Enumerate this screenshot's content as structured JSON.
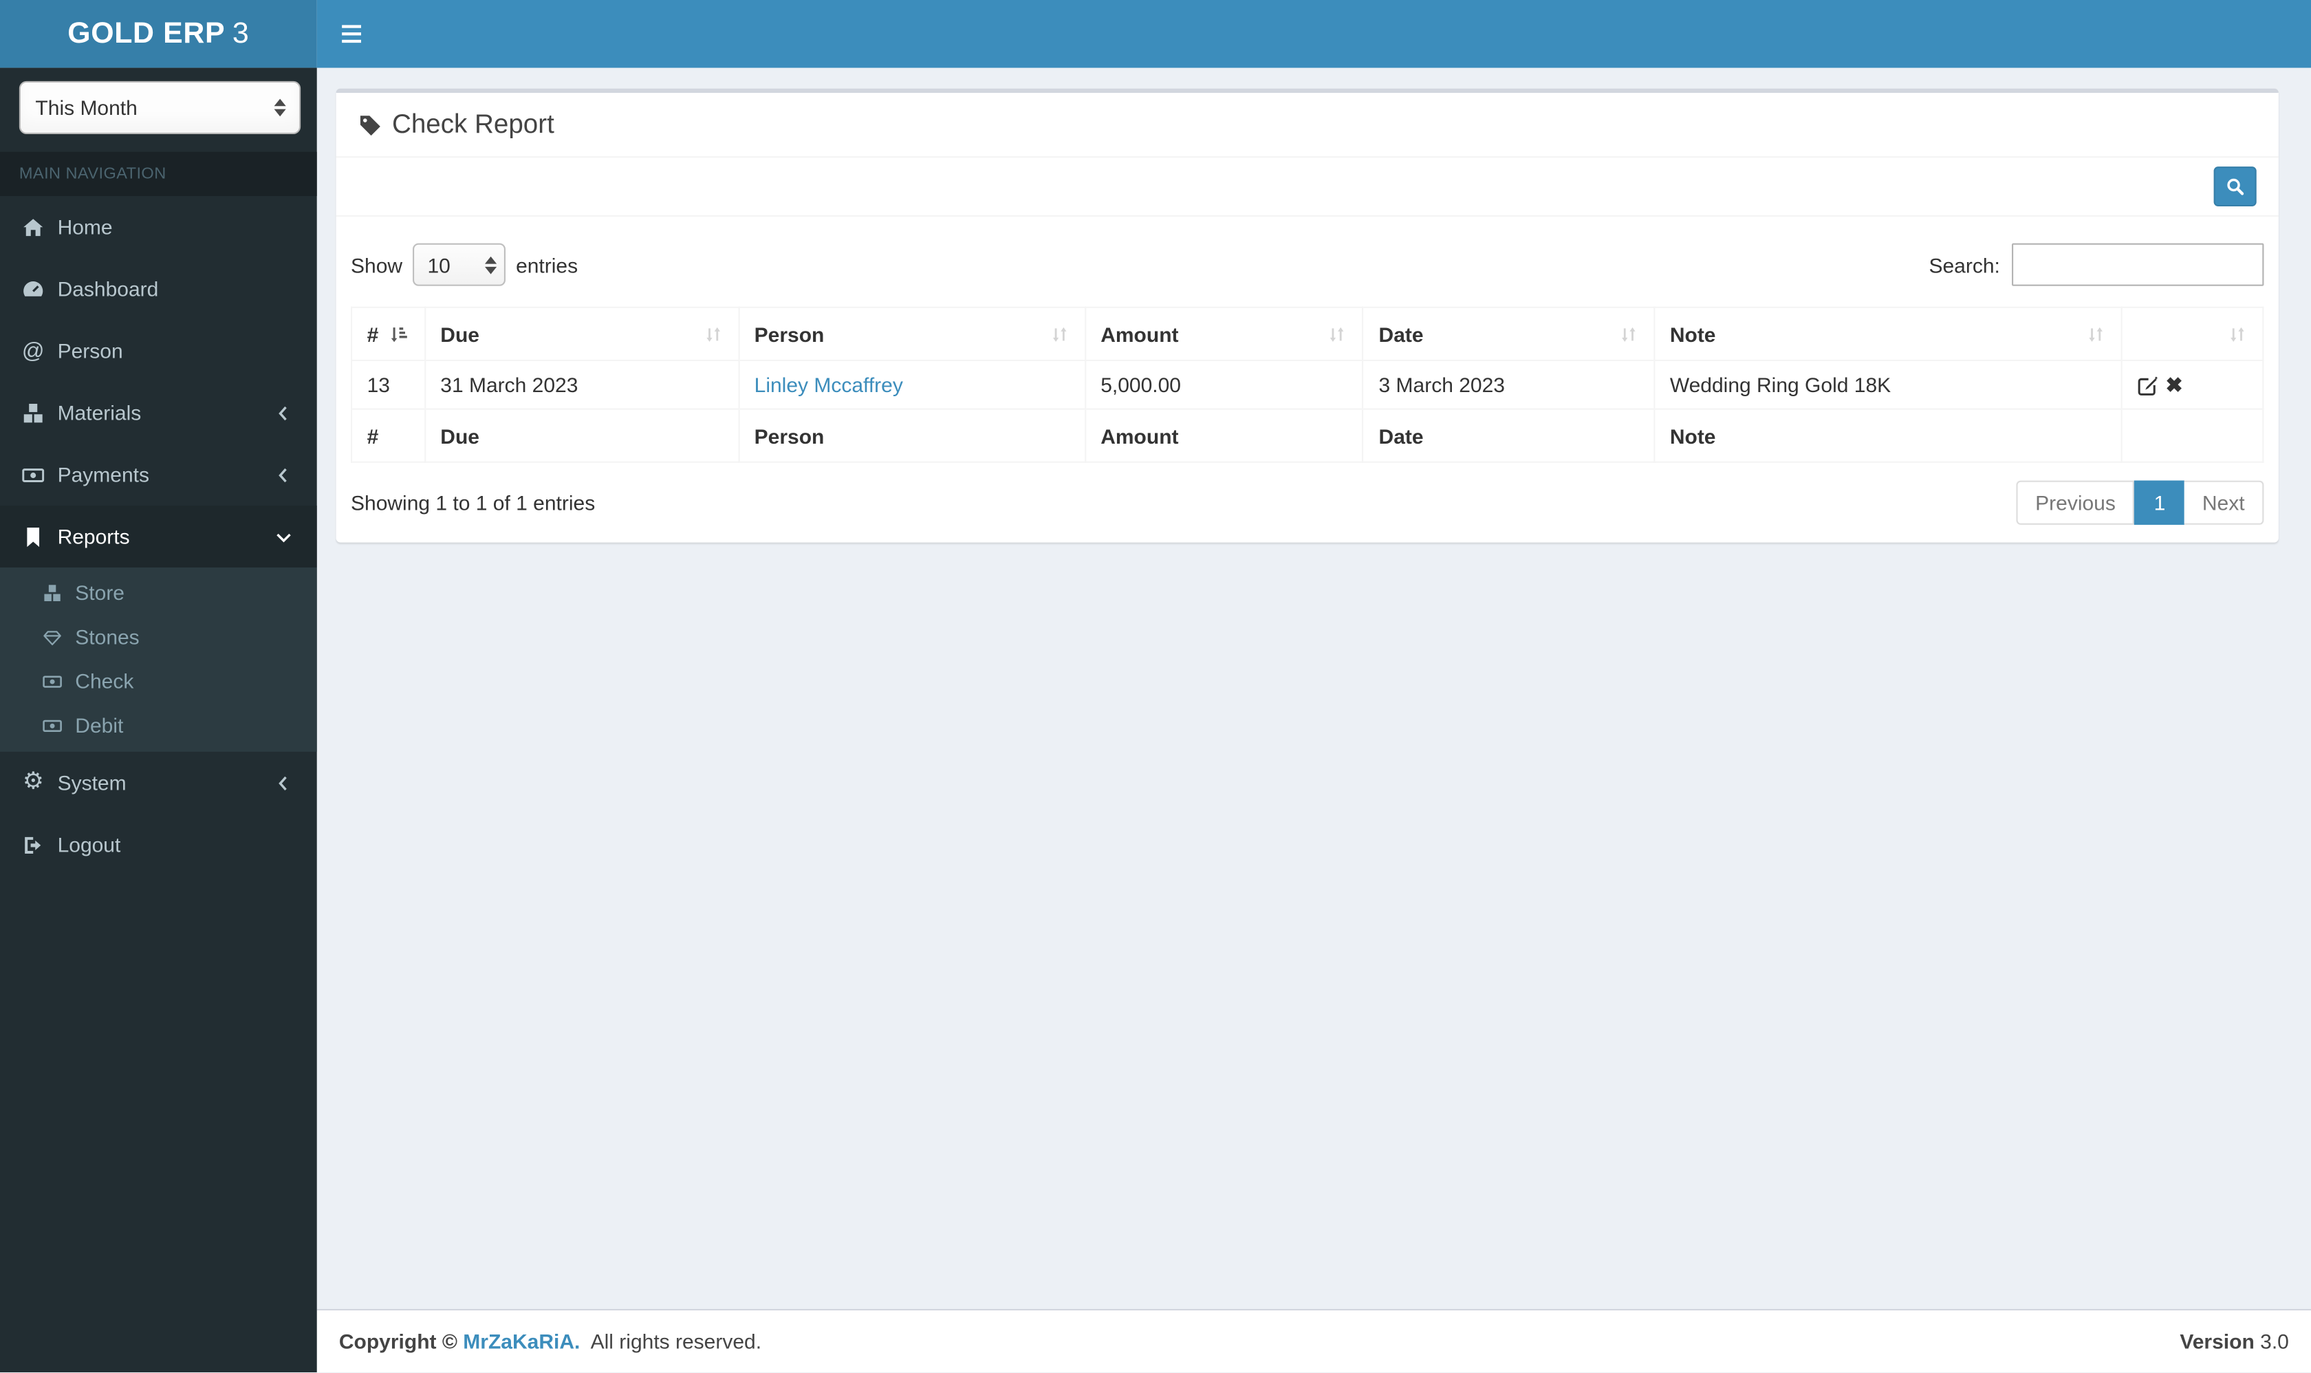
{
  "colors": {
    "primary": "#3c8dbc",
    "logo_bg": "#367fa9",
    "navbar_bg": "#3c8dbc",
    "sidebar_bg": "#222d32",
    "sidebar_active_bg": "#1e282c",
    "submenu_bg": "#2c3b41",
    "content_bg": "#ecf0f5",
    "link": "#3c8dbc",
    "table_border": "#f4f4f4"
  },
  "navbar": {
    "logo_text": "GOLD ERP",
    "logo_suffix": "3",
    "menu_icon": "hamburger-icon"
  },
  "sidebar": {
    "period_select": {
      "value": "This Month"
    },
    "section_header": "MAIN NAVIGATION",
    "items": [
      {
        "label": "Home",
        "icon": "home-icon"
      },
      {
        "label": "Dashboard",
        "icon": "dashboard-icon"
      },
      {
        "label": "Person",
        "icon": "at-icon"
      },
      {
        "label": "Materials",
        "icon": "cubes-icon",
        "chevron": "left"
      },
      {
        "label": "Payments",
        "icon": "money-icon",
        "chevron": "left"
      },
      {
        "label": "Reports",
        "icon": "bookmark-icon",
        "chevron": "down",
        "active": true
      },
      {
        "label": "System",
        "icon": "gear-icon",
        "chevron": "left"
      },
      {
        "label": "Logout",
        "icon": "logout-icon"
      }
    ],
    "reports_children": [
      {
        "label": "Store",
        "icon": "cubes-icon"
      },
      {
        "label": "Stones",
        "icon": "gem-icon"
      },
      {
        "label": "Check",
        "icon": "money-icon"
      },
      {
        "label": "Debit",
        "icon": "money-icon"
      }
    ]
  },
  "page": {
    "title": "Check Report",
    "title_icon": "tag-icon",
    "search_button_icon": "search-icon"
  },
  "table": {
    "show_label": "Show",
    "page_length": "10",
    "entries_label": "entries",
    "search_label": "Search:",
    "search_value": "",
    "columns": [
      "#",
      "Due",
      "Person",
      "Amount",
      "Date",
      "Note",
      ""
    ],
    "rows": [
      {
        "id": "13",
        "due": "31 March 2023",
        "person": "Linley Mccaffrey",
        "amount": "5,000.00",
        "date": "3 March 2023",
        "note": "Wedding Ring Gold 18K",
        "actions": [
          "edit-icon",
          "delete-icon"
        ]
      }
    ],
    "footer_columns": [
      "#",
      "Due",
      "Person",
      "Amount",
      "Date",
      "Note"
    ],
    "info": "Showing 1 to 1 of 1 entries",
    "pagination": {
      "previous": "Previous",
      "current": "1",
      "next": "Next"
    }
  },
  "footer": {
    "copyright_bold": "Copyright ©",
    "brand": "MrZaKaRiA.",
    "rights": "All rights reserved.",
    "version_label": "Version",
    "version": "3.0"
  }
}
